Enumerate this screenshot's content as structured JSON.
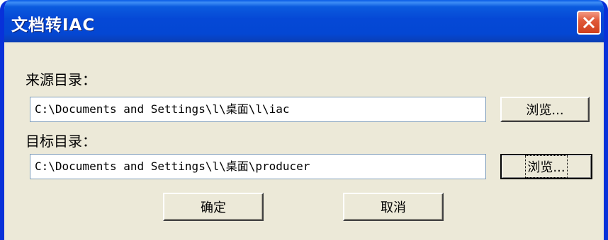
{
  "window": {
    "title": "文档转IAC",
    "close_symbol": "close-x-icon"
  },
  "source": {
    "label": "来源目录：",
    "value": "C:\\Documents and Settings\\l\\桌面\\l\\iac",
    "browse_label": "浏览..."
  },
  "target": {
    "label": "目标目录：",
    "value": "C:\\Documents and Settings\\l\\桌面\\producer",
    "browse_label": "浏览..."
  },
  "actions": {
    "ok_label": "确定",
    "cancel_label": "取消"
  },
  "colors": {
    "titlebar": "#0548d6",
    "close_button": "#e05a3a",
    "dialog_bg": "#ece9d8",
    "field_border": "#7f9db9"
  }
}
